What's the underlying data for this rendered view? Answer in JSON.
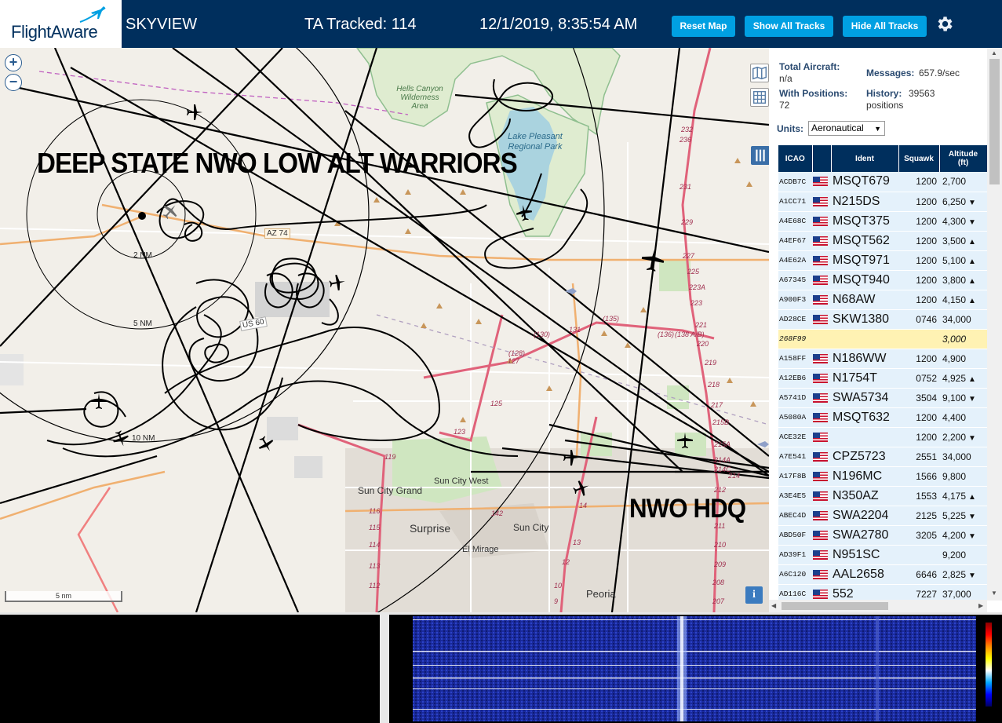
{
  "header": {
    "logo_text": "FlightAware",
    "app_title": "SKYVIEW",
    "tracked_label": "TA Tracked: 114",
    "datetime": "12/1/2019, 8:35:54 AM",
    "buttons": {
      "reset": "Reset Map",
      "show_all": "Show All Tracks",
      "hide_all": "Hide All Tracks"
    },
    "settings_icon": "gear-icon",
    "bg_color": "#002f5d",
    "button_color": "#00a0e2"
  },
  "map": {
    "annotations": [
      "DEEP STATE NWO LOW ALT WARRIORS",
      "NWO HDQ"
    ],
    "places": [
      "Hells Canyon Wilderness Area",
      "Lake Pleasant Regional Park",
      "Sun City Grand",
      "Sun City West",
      "Surprise",
      "Sun City",
      "El Mirage",
      "Peoria"
    ],
    "route_labels": [
      "AZ 74",
      "US 60",
      "(130)",
      "(135)",
      "(136)",
      "(138 A/B)",
      "(128)",
      "131",
      "127",
      "125",
      "123",
      "119",
      "116",
      "115",
      "114",
      "113",
      "112",
      "9",
      "10",
      "12",
      "13",
      "14",
      "142",
      "207",
      "208",
      "209",
      "210",
      "211",
      "212",
      "214",
      "214A",
      "214C",
      "215A",
      "215B",
      "217",
      "218",
      "219",
      "220",
      "221",
      "223",
      "223A",
      "225",
      "227",
      "229",
      "231",
      "232",
      "236"
    ],
    "range_rings": [
      "2 NM",
      "5 NM",
      "10 NM"
    ],
    "scale": "5 nm",
    "info_button": "i",
    "zoom": {
      "in": "+",
      "out": "−"
    }
  },
  "sidebar": {
    "stats": {
      "total_aircraft_label": "Total Aircraft:",
      "total_aircraft_value": "n/a",
      "with_positions_label": "With Positions:",
      "with_positions_value": "72",
      "messages_label": "Messages:",
      "messages_value": "657.9/sec",
      "history_label": "History:",
      "history_value": "39563",
      "history_unit": "positions"
    },
    "units_label": "Units:",
    "units_value": "Aeronautical",
    "columns": [
      "ICAO",
      "",
      "Ident",
      "Squawk",
      "Altitude (ft)"
    ],
    "rows": [
      {
        "icao": "ACDB7C",
        "ident": "MSQT679",
        "squawk": "1200",
        "alt": "2,700",
        "trend": ""
      },
      {
        "icao": "A1CC71",
        "ident": "N215DS",
        "squawk": "1200",
        "alt": "6,250",
        "trend": "▼"
      },
      {
        "icao": "A4E68C",
        "ident": "MSQT375",
        "squawk": "1200",
        "alt": "4,300",
        "trend": "▼"
      },
      {
        "icao": "A4EF67",
        "ident": "MSQT562",
        "squawk": "1200",
        "alt": "3,500",
        "trend": "▲"
      },
      {
        "icao": "A4E62A",
        "ident": "MSQT971",
        "squawk": "1200",
        "alt": "5,100",
        "trend": "▲"
      },
      {
        "icao": "A67345",
        "ident": "MSQT940",
        "squawk": "1200",
        "alt": "3,800",
        "trend": "▲"
      },
      {
        "icao": "A900F3",
        "ident": "N68AW",
        "squawk": "1200",
        "alt": "4,150",
        "trend": "▲"
      },
      {
        "icao": "AD28CE",
        "ident": "SKW1380",
        "squawk": "0746",
        "alt": "34,000",
        "trend": ""
      },
      {
        "icao": "268F99",
        "ident": "",
        "squawk": "",
        "alt": "3,000",
        "trend": "",
        "selected": true,
        "no_flag": true
      },
      {
        "icao": "A158FF",
        "ident": "N186WW",
        "squawk": "1200",
        "alt": "4,900",
        "trend": ""
      },
      {
        "icao": "A12EB6",
        "ident": "N1754T",
        "squawk": "0752",
        "alt": "4,925",
        "trend": "▲"
      },
      {
        "icao": "A5741D",
        "ident": "SWA5734",
        "squawk": "3504",
        "alt": "9,100",
        "trend": "▼"
      },
      {
        "icao": "A5080A",
        "ident": "MSQT632",
        "squawk": "1200",
        "alt": "4,400",
        "trend": ""
      },
      {
        "icao": "ACE32E",
        "ident": "",
        "squawk": "1200",
        "alt": "2,200",
        "trend": "▼"
      },
      {
        "icao": "A7E541",
        "ident": "CPZ5723",
        "squawk": "2551",
        "alt": "34,000",
        "trend": ""
      },
      {
        "icao": "A17F8B",
        "ident": "N196MC",
        "squawk": "1566",
        "alt": "9,800",
        "trend": ""
      },
      {
        "icao": "A3E4E5",
        "ident": "N350AZ",
        "squawk": "1553",
        "alt": "4,175",
        "trend": "▲"
      },
      {
        "icao": "ABEC4D",
        "ident": "SWA2204",
        "squawk": "2125",
        "alt": "5,225",
        "trend": "▼"
      },
      {
        "icao": "ABD50F",
        "ident": "SWA2780",
        "squawk": "3205",
        "alt": "4,200",
        "trend": "▼"
      },
      {
        "icao": "AD39F1",
        "ident": "N951SC",
        "squawk": "",
        "alt": "9,200",
        "trend": ""
      },
      {
        "icao": "A6C120",
        "ident": "AAL2658",
        "squawk": "6646",
        "alt": "2,825",
        "trend": "▼"
      },
      {
        "icao": "AD116C",
        "ident": "552",
        "squawk": "7227",
        "alt": "37,000",
        "trend": ""
      }
    ]
  }
}
